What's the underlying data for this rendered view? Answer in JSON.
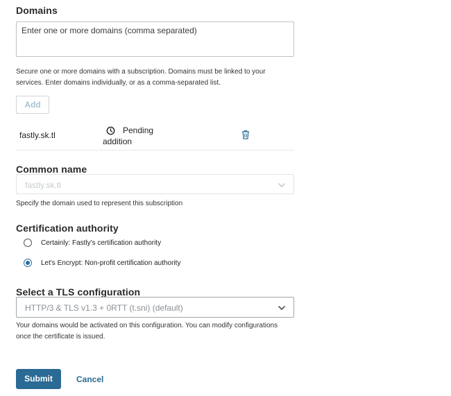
{
  "domains": {
    "heading": "Domains",
    "input_placeholder": "Enter one or more domains (comma separated)",
    "helper_line1": "Secure one or more domains with a subscription. Domains must be linked to your",
    "helper_line2": "services. Enter domains individually, or as a comma-separated list.",
    "add_label": "Add",
    "items": [
      {
        "name": "fastly.sk.tl",
        "status_line1": "Pending",
        "status_line2": "addition",
        "status_icon": "clock-icon",
        "delete_icon": "trash-icon"
      }
    ]
  },
  "common_name": {
    "heading": "Common name",
    "selected": "fastly.sk.tl",
    "helper": "Specify the domain used to represent this subscription"
  },
  "certification_authority": {
    "heading": "Certification authority",
    "options": [
      {
        "label": "Certainly: Fastly's certification authority",
        "selected": false
      },
      {
        "label": "Let's Encrypt: Non-profit certification authority",
        "selected": true
      }
    ]
  },
  "tls": {
    "heading": "Select a TLS configuration",
    "selected": "HTTP/3 & TLS v1.3 + 0RTT (t.sni) (default)",
    "helper_line1": "Your domains would be activated on this configuration. You can modify configurations",
    "helper_line2": "once the certificate is issued."
  },
  "actions": {
    "submit_label": "Submit",
    "cancel_label": "Cancel"
  },
  "colors": {
    "primary": "#2a6a95",
    "disabled_text": "#b8c2ca",
    "border": "#c7ccd1"
  }
}
